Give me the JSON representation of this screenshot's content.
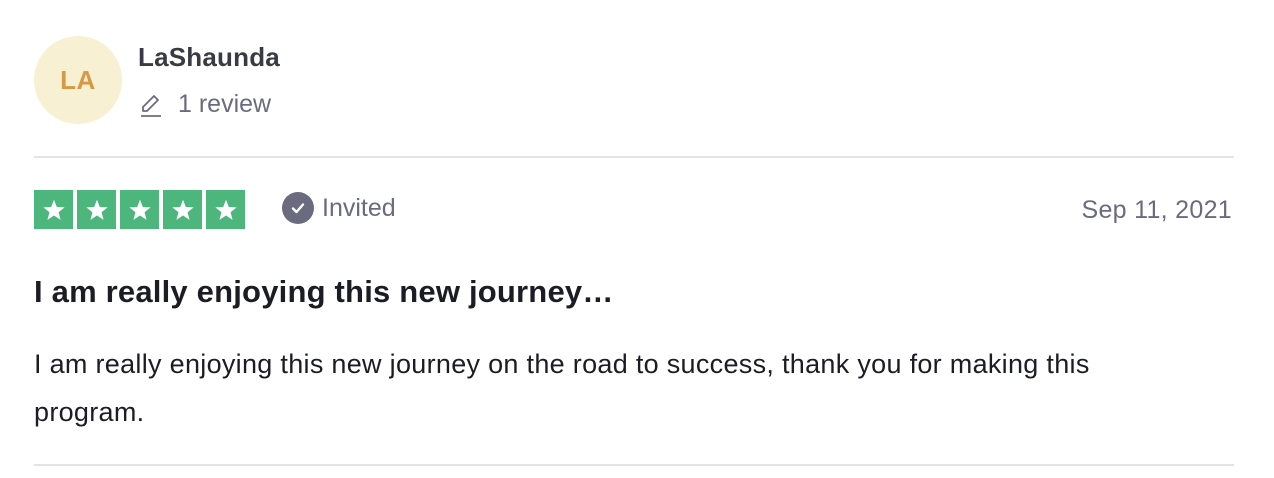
{
  "reviewer": {
    "initials": "LA",
    "name": "LaShaunda",
    "review_count": "1 review",
    "avatar_bg": "#f8f0d2",
    "avatar_fg": "#d69a45"
  },
  "review": {
    "rating": 5,
    "rating_max": 5,
    "star_color": "#4cb67d",
    "verification_label": "Invited",
    "date": "Sep 11, 2021",
    "title": "I am really enjoying this new journey…",
    "body": "I am really enjoying this new journey on the road to success, thank you for making this program."
  },
  "icons": {
    "review_count_icon": "pencil-icon",
    "verification_icon": "check-circle-icon",
    "star_icon": "star-icon"
  }
}
